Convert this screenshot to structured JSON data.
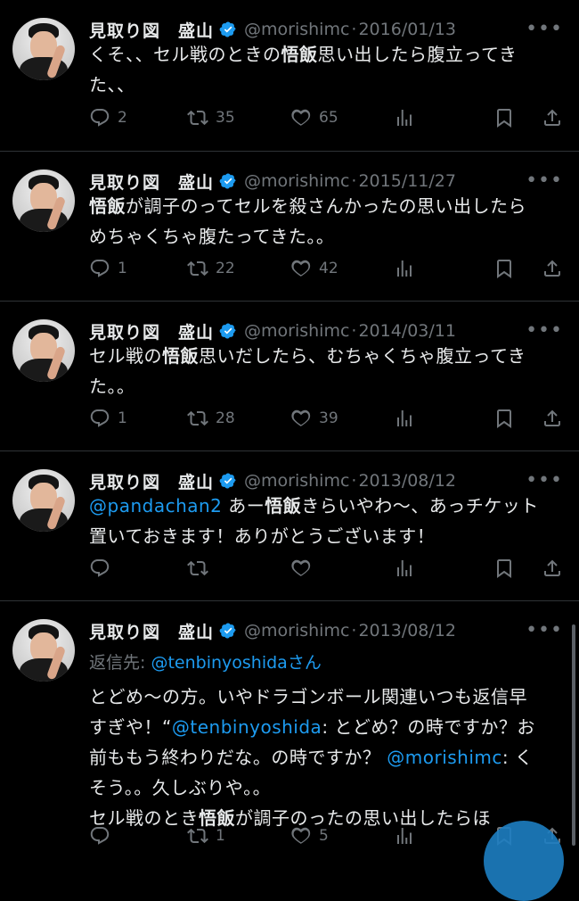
{
  "colors": {
    "background": "#000000",
    "text": "#e7e9ea",
    "muted": "#71767b",
    "link": "#1d9bf0",
    "verified": "#1d9bf0",
    "divider": "#2f3336"
  },
  "icons": {
    "reply": "reply-icon",
    "retweet": "retweet-icon",
    "like": "heart-icon",
    "views": "views-icon",
    "bookmark": "bookmark-icon",
    "share": "share-icon",
    "verified": "verified-badge-icon",
    "more": "more-icon"
  },
  "tweets": [
    {
      "name": "見取り図　盛山",
      "handle": "@morishimc",
      "sep": "·",
      "date": "2016/01/13",
      "more": "•••",
      "text_line1_a": "くそ、、セル戦のときの",
      "text_line1_b": "悟飯",
      "text_line1_c": "思い出したら腹立ってき",
      "text_line2": "た、、",
      "replies": "2",
      "retweets": "35",
      "likes": "65"
    },
    {
      "name": "見取り図　盛山",
      "handle": "@morishimc",
      "sep": "·",
      "date": "2015/11/27",
      "more": "•••",
      "text_line1_a": "悟飯",
      "text_line1_b": "が調子のってセルを殺さんかったの思い出したら",
      "text_line2": "めちゃくちゃ腹たってきた。。",
      "replies": "1",
      "retweets": "22",
      "likes": "42"
    },
    {
      "name": "見取り図　盛山",
      "handle": "@morishimc",
      "sep": "·",
      "date": "2014/03/11",
      "more": "•••",
      "text_line1_a": "セル戦の",
      "text_line1_b": "悟飯",
      "text_line1_c": "思いだしたら、むちゃくちゃ腹立ってき",
      "text_line2": "た。。",
      "replies": "1",
      "retweets": "28",
      "likes": "39"
    },
    {
      "name": "見取り図　盛山",
      "handle": "@morishimc",
      "sep": "·",
      "date": "2013/08/12",
      "more": "•••",
      "mention": "@pandachan2",
      "text_line1_a": " あー",
      "text_line1_b": "悟飯",
      "text_line1_c": "きらいやわ〜、あっチケット",
      "text_line2": "置いておきます！ありがとうございます！",
      "replies": "",
      "retweets": "",
      "likes": ""
    },
    {
      "name": "見取り図　盛山",
      "handle": "@morishimc",
      "sep": "·",
      "date": "2013/08/12",
      "more": "•••",
      "reply_prefix": "返信先: ",
      "reply_handle": "@tenbinyoshida",
      "reply_suffix": "さん",
      "line1": "とどめ〜の方。いやドラゴンボール関連いつも返信早",
      "line2_a": "すぎや！“",
      "line2_link": "@tenbinyoshida",
      "line2_b": ": とどめ？の時ですか？お",
      "line3_a": "前ももう終わりだな。の時ですか？ ",
      "line3_link": "@morishimc",
      "line3_b": ": く",
      "line4": "そう。。久しぶりや。。",
      "line5_a": "セル戦のとき",
      "line5_b": "悟飯",
      "line5_c": "が調子のったの思い出したらほ",
      "replies": "",
      "retweets": "1",
      "likes": "5"
    }
  ]
}
